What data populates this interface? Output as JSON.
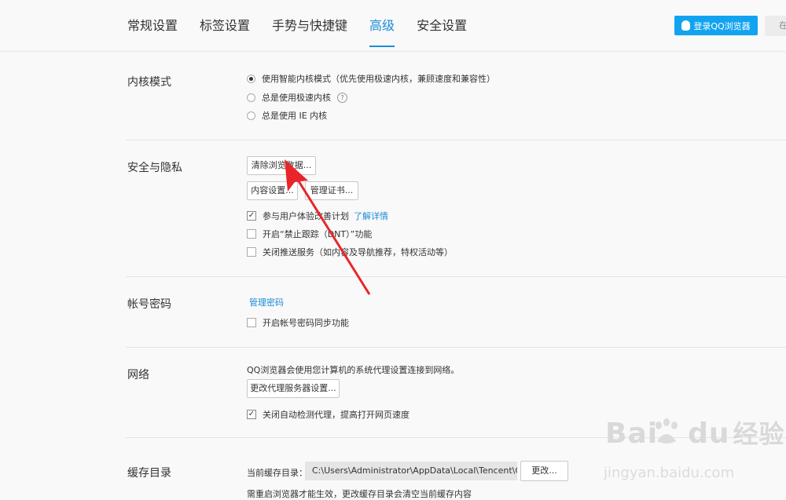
{
  "tabs": [
    "常规设置",
    "标签设置",
    "手势与快捷键",
    "高级",
    "安全设置"
  ],
  "active_tab_index": 3,
  "login_button": "登录QQ浏览器",
  "search_placeholder": "在",
  "kernel": {
    "title": "内核模式",
    "options": [
      "使用智能内核模式（优先使用极速内核，兼顾速度和兼容性）",
      "总是使用极速内核",
      "总是使用 IE 内核"
    ],
    "selected_index": 0,
    "help": "?"
  },
  "security": {
    "title": "安全与隐私",
    "clear_button": "清除浏览数据...",
    "content_button": "内容设置...",
    "cert_button": "管理证书...",
    "checkboxes": [
      {
        "label": "参与用户体验改善计划",
        "checked": true,
        "link": "了解详情"
      },
      {
        "label": "开启“禁止跟踪（DNT）”功能",
        "checked": false
      },
      {
        "label": "关闭推送服务（如内容及导航推荐，特权活动等）",
        "checked": false
      }
    ]
  },
  "account": {
    "title": "帐号密码",
    "manage_link": "管理密码",
    "sync_label": "开启帐号密码同步功能",
    "sync_checked": false
  },
  "network": {
    "title": "网络",
    "desc": "QQ浏览器会使用您计算机的系统代理设置连接到网络。",
    "proxy_button": "更改代理服务器设置...",
    "auto_detect_label": "关闭自动检测代理，提高打开网页速度",
    "auto_detect_checked": true
  },
  "cache": {
    "title": "缓存目录",
    "label": "当前缓存目录：",
    "path": "C:\\Users\\Administrator\\AppData\\Local\\Tencent\\QQ",
    "change_button": "更改...",
    "note": "需重启浏览器才能生效，更改缓存目录会清空当前缓存内容"
  },
  "watermark": {
    "brand": "Bai",
    "brand2": "du",
    "cn": "经验",
    "url": "jingyan.baidu.com"
  },
  "colors": {
    "accent": "#1a8cd8",
    "login_bg": "#12a3f0",
    "arrow": "#e8262a"
  }
}
